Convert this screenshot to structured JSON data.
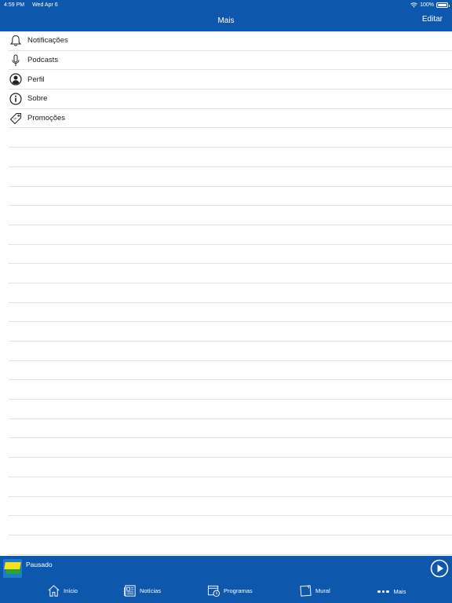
{
  "status": {
    "time": "4:59 PM",
    "date": "Wed Apr 6",
    "battery": "100%"
  },
  "nav": {
    "title": "Mais",
    "edit_label": "Editar"
  },
  "menu": [
    {
      "label": "Notificações",
      "icon": "bell-icon"
    },
    {
      "label": "Podcasts",
      "icon": "microphone-icon"
    },
    {
      "label": "Perfil",
      "icon": "user-icon"
    },
    {
      "label": "Sobre",
      "icon": "info-icon"
    },
    {
      "label": "Promoções",
      "icon": "tag-icon"
    }
  ],
  "player": {
    "status": "Pausado"
  },
  "tabs": [
    {
      "label": "Início",
      "icon": "home-icon"
    },
    {
      "label": "Notícias",
      "icon": "newspaper-icon"
    },
    {
      "label": "Programas",
      "icon": "calendar-clock-icon"
    },
    {
      "label": "Mural",
      "icon": "board-icon"
    },
    {
      "label": "Mais",
      "icon": "more-dots-icon"
    }
  ],
  "colors": {
    "brand": "#0d57ad",
    "separator": "#e2e2e2",
    "text": "#1c1c1c"
  }
}
